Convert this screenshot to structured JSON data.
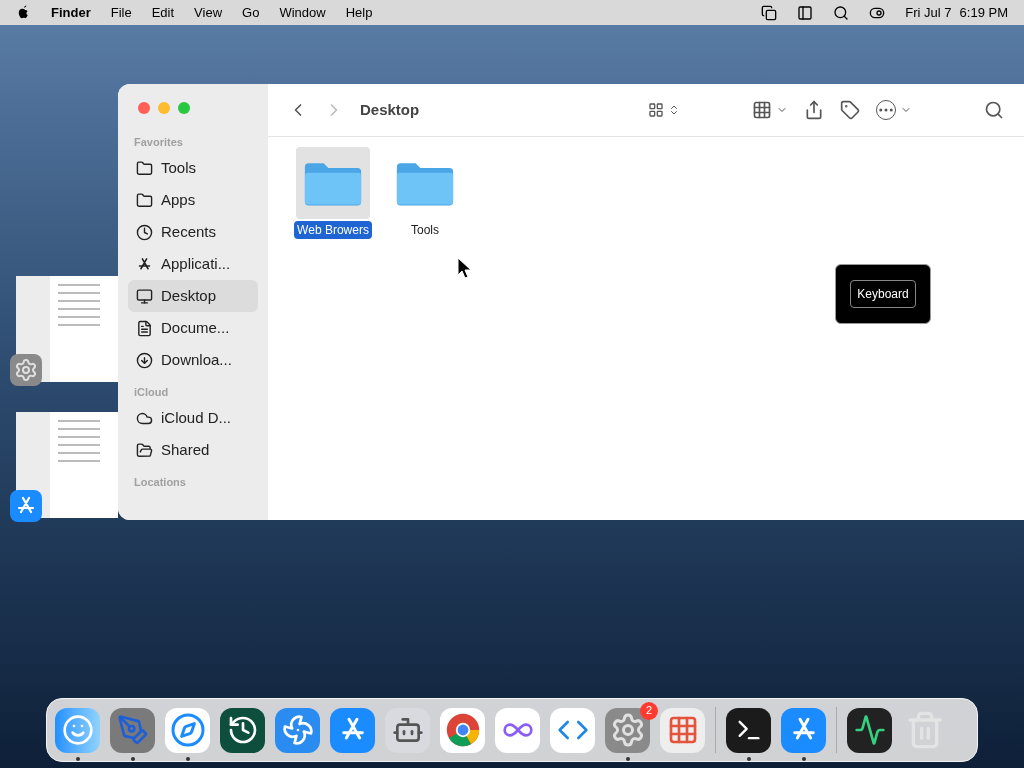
{
  "menu_bar": {
    "app_name": "Finder",
    "menus": [
      "File",
      "Edit",
      "View",
      "Go",
      "Window",
      "Help"
    ],
    "date": "Fri Jul 7",
    "time": "6:19 PM"
  },
  "finder": {
    "title": "Desktop",
    "sidebar": [
      {
        "heading": "Favorites",
        "items": [
          {
            "label": "Tools",
            "kind": "folder",
            "selected": false
          },
          {
            "label": "Apps",
            "kind": "folder",
            "selected": false
          },
          {
            "label": "Recents",
            "kind": "clock",
            "selected": false
          },
          {
            "label": "Applicati...",
            "kind": "apps",
            "selected": false
          },
          {
            "label": "Desktop",
            "kind": "desktop",
            "selected": true
          },
          {
            "label": "Docume...",
            "kind": "document",
            "selected": false
          },
          {
            "label": "Downloa...",
            "kind": "download",
            "selected": false
          }
        ]
      },
      {
        "heading": "iCloud",
        "items": [
          {
            "label": "iCloud D...",
            "kind": "cloud",
            "selected": false
          },
          {
            "label": "Shared",
            "kind": "shared",
            "selected": false
          }
        ]
      },
      {
        "heading": "Locations"
      }
    ],
    "files": [
      {
        "name": "Web Browers",
        "selected": true
      },
      {
        "name": "Tools",
        "selected": false
      }
    ]
  },
  "keyboard_popup": {
    "label": "Keyboard"
  },
  "stage_thumbnails": [
    {
      "kind": "settings"
    },
    {
      "kind": "appstore"
    }
  ],
  "dock": [
    {
      "kind": "finder",
      "running": true
    },
    {
      "kind": "sketch",
      "running": true
    },
    {
      "kind": "safari",
      "running": true
    },
    {
      "kind": "timemachine",
      "running": false
    },
    {
      "kind": "fan",
      "running": false
    },
    {
      "kind": "appstore",
      "running": false
    },
    {
      "kind": "automator",
      "running": false
    },
    {
      "kind": "chrome",
      "running": false
    },
    {
      "kind": "visualstudio",
      "running": false
    },
    {
      "kind": "vscode",
      "running": false
    },
    {
      "kind": "settings",
      "running": true,
      "badge": "2"
    },
    {
      "kind": "launchpad",
      "running": false
    },
    {
      "kind": "separator"
    },
    {
      "kind": "terminal",
      "running": true
    },
    {
      "kind": "appstore",
      "running": true
    },
    {
      "kind": "separator"
    },
    {
      "kind": "activity",
      "running": false
    },
    {
      "kind": "trash",
      "running": false
    }
  ]
}
